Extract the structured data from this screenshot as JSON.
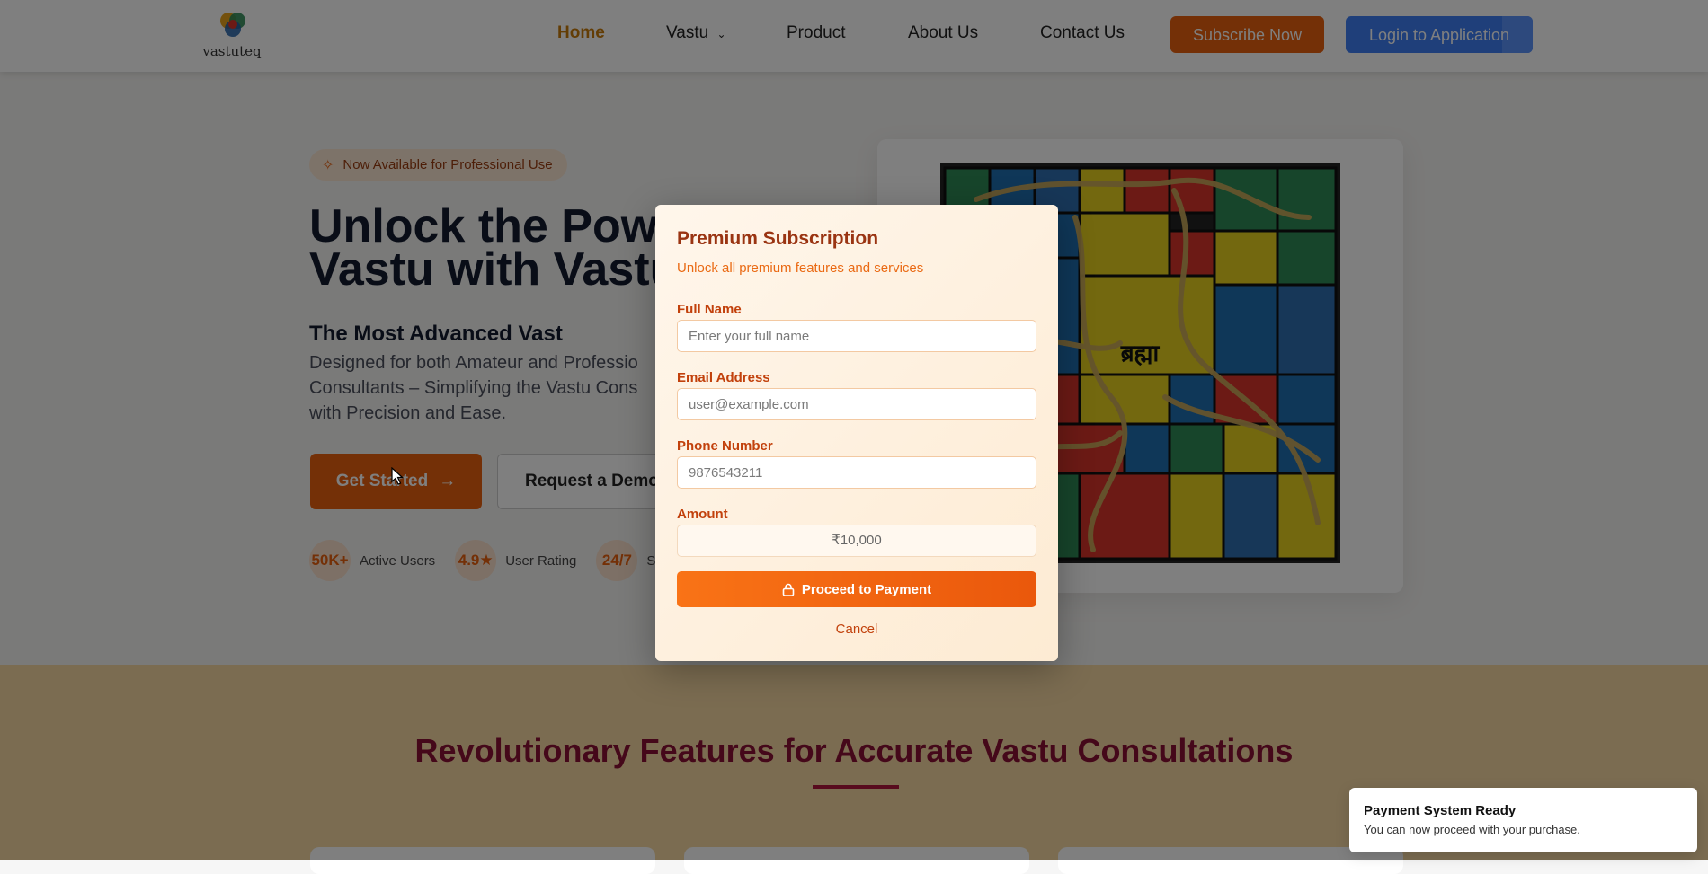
{
  "brand": {
    "name": "vastuteq"
  },
  "nav": {
    "items": [
      {
        "label": "Home",
        "active": true
      },
      {
        "label": "Vastu",
        "has_dropdown": true
      },
      {
        "label": "Product"
      },
      {
        "label": "About Us"
      },
      {
        "label": "Contact Us"
      }
    ],
    "subscribe_label": "Subscribe Now",
    "login_label": "Login to Application"
  },
  "hero": {
    "badge": "Now Available for Professional Use",
    "title_line1": "Unlock the Powe",
    "title_line2": "Vastu with Vastu",
    "subtitle": "The Most Advanced Vast",
    "desc_line1": "Designed for both Amateur and Professio",
    "desc_line2": "Consultants – Simplifying the Vastu Cons",
    "desc_line3": "with Precision and Ease.",
    "get_started_label": "Get Started",
    "demo_label": "Request a Demo",
    "stats": [
      {
        "value": "50K+",
        "label": "Active Users"
      },
      {
        "value": "4.9★",
        "label": "User Rating"
      },
      {
        "value": "24/7",
        "label": "S"
      }
    ],
    "image_center_label": "ब्रह्मा"
  },
  "features": {
    "title": "Revolutionary Features for Accurate Vastu Consultations"
  },
  "modal": {
    "title": "Premium Subscription",
    "subtitle": "Unlock all premium features and services",
    "fields": {
      "full_name": {
        "label": "Full Name",
        "placeholder": "Enter your full name",
        "value": ""
      },
      "email": {
        "label": "Email Address",
        "placeholder": "user@example.com",
        "value": ""
      },
      "phone": {
        "label": "Phone Number",
        "placeholder": "9876543211",
        "value": ""
      },
      "amount": {
        "label": "Amount",
        "value": "₹10,000"
      }
    },
    "pay_label": "Proceed to Payment",
    "cancel_label": "Cancel"
  },
  "toast": {
    "title": "Payment System Ready",
    "message": "You can now proceed with your purchase."
  },
  "colors": {
    "accent": "#e8610f",
    "login": "#3f7ef5",
    "nav_active": "#c77a0a",
    "features_title": "#8b1034",
    "modal_title": "#9a3412"
  }
}
